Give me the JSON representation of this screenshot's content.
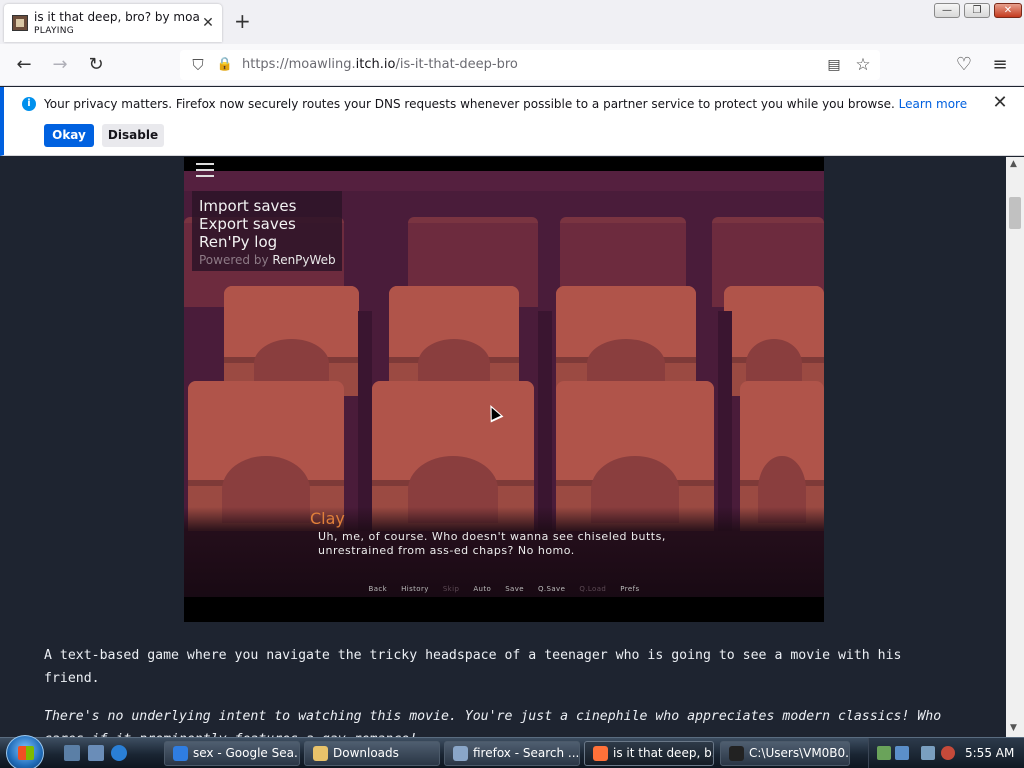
{
  "window": {
    "tab_title": "is it that deep, bro? by moawling",
    "tab_status": "PLAYING",
    "close_glyph": "✕",
    "newtab_glyph": "+",
    "controls": {
      "minimize": "—",
      "maximize": "❐",
      "close": "✕"
    }
  },
  "navbar": {
    "back_glyph": "←",
    "forward_glyph": "→",
    "reload_glyph": "↻",
    "url_prefix": "https://moawling.",
    "url_domain": "itch.io",
    "url_path": "/is-it-that-deep-bro",
    "shield_glyph": "⛉",
    "lock_glyph": "🔒",
    "reader_glyph": "▤",
    "star_glyph": "☆",
    "pocket_glyph": "♡",
    "menu_glyph": "≡"
  },
  "notification": {
    "message": "Your privacy matters. Firefox now securely routes your DNS requests whenever possible to a partner service to protect you while you browse.",
    "learn_more": "Learn more",
    "okay_label": "Okay",
    "disable_label": "Disable",
    "close_glyph": "✕"
  },
  "game": {
    "menu": {
      "import": "Import saves",
      "export": "Export saves",
      "log": "Ren'Py log",
      "powered_prefix": "Powered by",
      "powered_name": "RenPyWeb"
    },
    "speaker": "Clay",
    "dialogue": "Uh, me, of course. Who doesn't wanna see chiseled butts, unrestrained from ass-ed chaps? No homo.",
    "quick_menu": [
      {
        "label": "Back",
        "enabled": true
      },
      {
        "label": "History",
        "enabled": true
      },
      {
        "label": "Skip",
        "enabled": false
      },
      {
        "label": "Auto",
        "enabled": true
      },
      {
        "label": "Save",
        "enabled": true
      },
      {
        "label": "Q.Save",
        "enabled": true
      },
      {
        "label": "Q.Load",
        "enabled": false
      },
      {
        "label": "Prefs",
        "enabled": true
      }
    ]
  },
  "description": {
    "para1": "A text-based game where you navigate the tricky headspace of a teenager who is going to see a movie with his friend.",
    "para2": "There's no underlying intent to watching this movie. You're just a cinephile who appreciates modern classics! Who cares if it prominently features a gay romance!"
  },
  "taskbar": {
    "items": [
      {
        "label": "sex - Google Sea...",
        "icon": "chrome-icon",
        "color": "#2f7de1"
      },
      {
        "label": "Downloads",
        "icon": "folder-icon",
        "color": "#e8c26a"
      },
      {
        "label": "firefox - Search ...",
        "icon": "search-window-icon",
        "color": "#8aa6c8"
      },
      {
        "label": "is it that deep, b...",
        "icon": "firefox-icon",
        "color": "#ff7139",
        "active": true
      },
      {
        "label": "C:\\Users\\VM0B0...",
        "icon": "cmd-icon",
        "color": "#222222"
      }
    ],
    "clock": "5:55 AM"
  },
  "colors": {
    "page_bg": "#1e2430",
    "accent": "#0061e0",
    "speaker": "#e07f3a"
  }
}
